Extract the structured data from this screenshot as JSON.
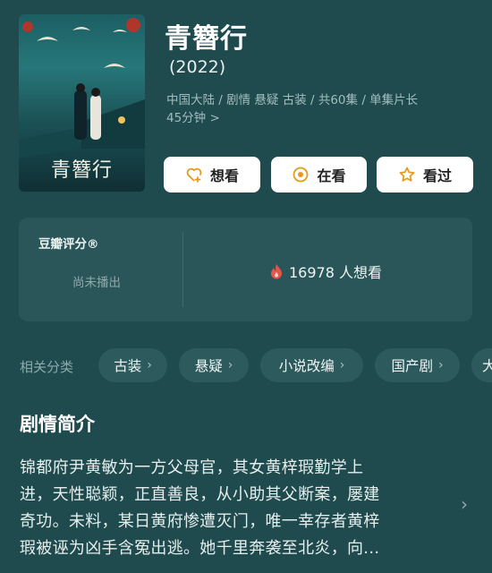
{
  "poster": {
    "title_text": "青簪行",
    "icon": "poster-image"
  },
  "header": {
    "title": "青簪行",
    "year": "(2022)",
    "meta_line1": "中国大陆 / 剧情 悬疑 古装 / 共60集 / 单集片长",
    "meta_line2": "45分钟 >"
  },
  "actions": {
    "want": {
      "label": "想看",
      "icon": "heart-plus-icon"
    },
    "watching": {
      "label": "在看",
      "icon": "target-icon"
    },
    "watched": {
      "label": "看过",
      "icon": "star-icon"
    }
  },
  "rating": {
    "label": "豆瓣评分®",
    "status": "尚未播出",
    "want_count": "16978 人想看",
    "want_icon": "flame-icon"
  },
  "categories": {
    "label": "相关分类",
    "items": [
      "古装",
      "悬疑",
      "小说改编",
      "国产剧",
      "大"
    ]
  },
  "synopsis": {
    "title": "剧情简介",
    "line1": "锦都府尹黄敏为一方父母官，其女黄梓瑕勤学上",
    "line2": "进，天性聪颖，正直善良，从小助其父断案，屡建",
    "line3": "奇功。未料，某日黄府惨遭灭门，唯一幸存者黄梓",
    "line4": "瑕被诬为凶手含冤出逃。她千里奔袭至北炎，向..."
  },
  "colors": {
    "background": "#1f4a4e",
    "card": "#2b5659",
    "chip": "#2d5a5d",
    "accent_orange": "#e59a1c",
    "flame_red": "#e8534a"
  }
}
